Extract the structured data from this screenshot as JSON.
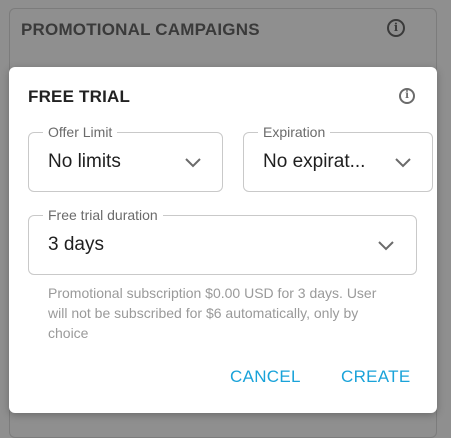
{
  "background": {
    "title": "PROMOTIONAL CAMPAIGNS",
    "info_icon": "info-icon"
  },
  "dialog": {
    "title": "FREE TRIAL",
    "info_icon": "info-icon",
    "offer_limit": {
      "label": "Offer Limit",
      "value": "No limits",
      "icon": "chevron-down-icon"
    },
    "expiration": {
      "label": "Expiration",
      "value": "No expirat...",
      "icon": "chevron-down-icon"
    },
    "free_trial_duration": {
      "label": "Free trial duration",
      "value": "3 days",
      "icon": "chevron-down-icon"
    },
    "helper_text": "Promotional subscription $0.00 USD for 3 days. User will not be subscribed for $6 automatically, only by choice",
    "cancel_label": "CANCEL",
    "create_label": "CREATE"
  },
  "colors": {
    "accent": "#1aa3d9",
    "overlay": "#8f8f8f",
    "border": "#c9c9c9"
  }
}
